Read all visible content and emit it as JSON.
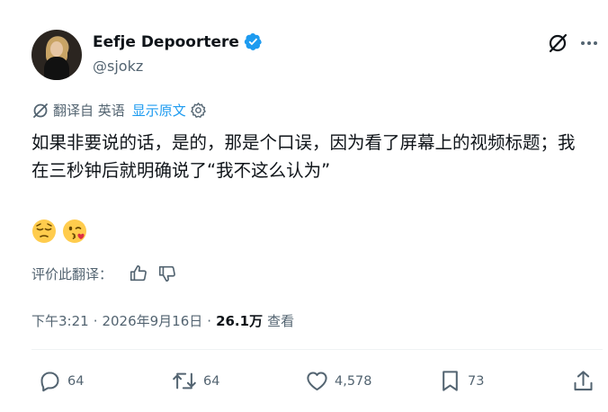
{
  "author": {
    "name": "Eefje Depoortere",
    "handle": "@sjokz",
    "verified": true
  },
  "translation": {
    "label": "翻译自 英语",
    "show_original": "显示原文"
  },
  "tweet": {
    "text": "如果非要说的话，是的，那是个口误，因为看了屏幕上的视频标题；我在三秒钟后就明确说了“我不这么认为”",
    "emojis": [
      "😔",
      "😘"
    ]
  },
  "rating": {
    "label": "评价此翻译："
  },
  "meta": {
    "time": "下午3:21",
    "separator": "·",
    "date": "2026年9月16日",
    "views_count": "26.1万",
    "views_label": "查看"
  },
  "actions": {
    "replies": "64",
    "reposts": "64",
    "likes": "4,578",
    "bookmarks": "73"
  },
  "colors": {
    "text": "#0f1419",
    "secondary": "#536471",
    "accent": "#1d9bf0",
    "divider": "#eff3f4"
  },
  "icons": [
    "verified-badge-icon",
    "grok-icon",
    "more-icon",
    "translate-icon",
    "settings-gear-icon",
    "thumbs-up-icon",
    "thumbs-down-icon",
    "reply-icon",
    "repost-icon",
    "like-icon",
    "bookmark-icon",
    "share-icon"
  ]
}
